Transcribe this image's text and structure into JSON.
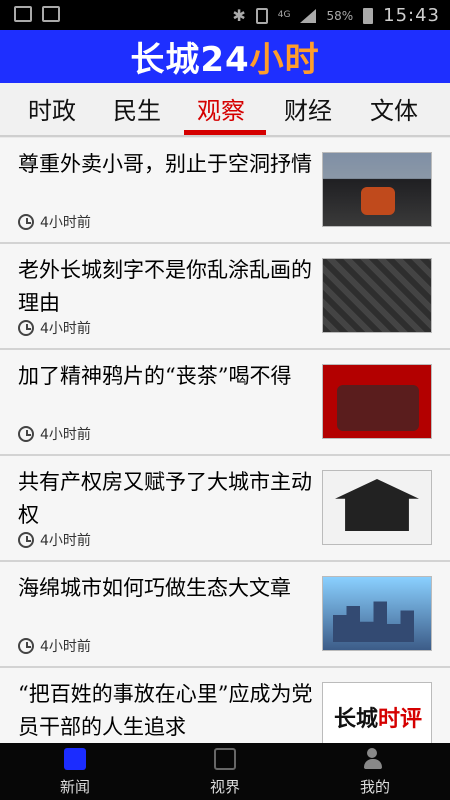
{
  "status_bar": {
    "network": "4G",
    "battery": "58%",
    "time": "15:43"
  },
  "header": {
    "logo_text_prefix": "长城",
    "logo_text_number": "24",
    "logo_text_suffix": "小时"
  },
  "tabs": [
    {
      "label": "时政"
    },
    {
      "label": "民生"
    },
    {
      "label": "观察"
    },
    {
      "label": "财经"
    },
    {
      "label": "文体"
    }
  ],
  "articles": [
    {
      "title": "尊重外卖小哥，别止于空洞抒情",
      "time": "4小时前"
    },
    {
      "title": "老外长城刻字不是你乱涂乱画的理由",
      "time": "4小时前"
    },
    {
      "title": "加了精神鸦片的“丧茶”喝不得",
      "time": "4小时前"
    },
    {
      "title": "共有产权房又赋予了大城市主动权",
      "time": "4小时前"
    },
    {
      "title": "海绵城市如何巧做生态大文章",
      "time": "4小时前"
    },
    {
      "title": "“把百姓的事放在心里”应成为党员干部的人生追求",
      "time": ""
    }
  ],
  "thumb6": {
    "text_a": "长城",
    "text_b": "时评"
  },
  "bottom_nav": [
    {
      "label": "新闻"
    },
    {
      "label": "视界"
    },
    {
      "label": "我的"
    }
  ],
  "colors": {
    "brand_blue": "#1e2fff",
    "accent_red": "#d50000",
    "accent_orange": "#ff9d2b"
  }
}
